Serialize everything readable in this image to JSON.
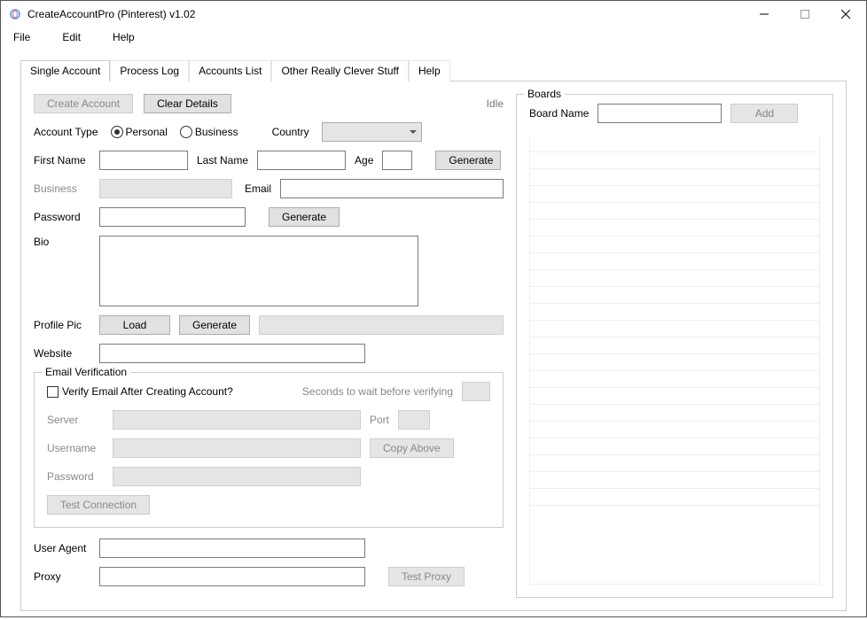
{
  "window": {
    "title": "CreateAccountPro (Pinterest) v1.02"
  },
  "menu": {
    "file": "File",
    "edit": "Edit",
    "help": "Help"
  },
  "tabs": {
    "single_account": "Single Account",
    "process_log": "Process Log",
    "accounts_list": "Accounts List",
    "clever": "Other Really Clever Stuff",
    "help": "Help"
  },
  "buttons": {
    "create_account": "Create Account",
    "clear_details": "Clear Details",
    "generate": "Generate",
    "load": "Load",
    "copy_above": "Copy Above",
    "test_connection": "Test Connection",
    "test_proxy": "Test Proxy",
    "add": "Add"
  },
  "labels": {
    "account_type": "Account Type",
    "personal": "Personal",
    "business": "Business",
    "country": "Country",
    "first_name": "First Name",
    "last_name": "Last Name",
    "age": "Age",
    "business_label": "Business",
    "email": "Email",
    "password": "Password",
    "bio": "Bio",
    "profile_pic": "Profile Pic",
    "website": "Website",
    "email_verification": "Email Verification",
    "verify_checkbox": "Verify Email After Creating Account?",
    "seconds_wait": "Seconds to wait before verifying",
    "server": "Server",
    "port": "Port",
    "username": "Username",
    "ev_password": "Password",
    "user_agent": "User Agent",
    "proxy": "Proxy",
    "boards": "Boards",
    "board_name": "Board Name",
    "status": "Idle"
  },
  "values": {
    "country": "",
    "first_name": "",
    "last_name": "",
    "age": "",
    "business": "",
    "email": "",
    "password": "",
    "bio": "",
    "profile_pic_path": "",
    "website": "",
    "seconds": "",
    "server": "",
    "port": "",
    "ev_username": "",
    "ev_password": "",
    "user_agent": "",
    "proxy": "",
    "board_name": ""
  }
}
